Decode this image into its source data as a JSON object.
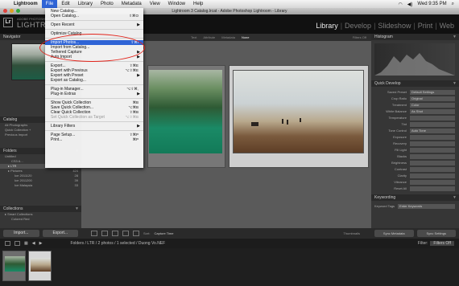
{
  "macbar": {
    "items": [
      "Lightroom",
      "File",
      "Edit",
      "Library",
      "Photo",
      "Metadata",
      "View",
      "Window",
      "Help"
    ],
    "clock": "Wed 9:35 PM"
  },
  "window": {
    "title": "Lightroom 3 Catalog.lrcat - Adobe Photoshop Lightroom - Library"
  },
  "identity": {
    "logo": "Lr",
    "small": "ADOBE PHOTOSHOP",
    "big": "LIGHTROOM"
  },
  "modules": [
    "Library",
    "Develop",
    "Slideshow",
    "Print",
    "Web"
  ],
  "left_panel": {
    "navigator": "Navigator",
    "catalog": "Catalog",
    "catalog_items": [
      "All Photographs",
      "Quick Collection +",
      "Previous Import"
    ],
    "folders": "Folders",
    "folder_items": [
      {
        "name": "Untitled",
        "count": ""
      },
      {
        "name": "CS3 A...",
        "count": ""
      },
      {
        "name": "LTR",
        "count": ""
      },
      {
        "name": "Pictures",
        "count": "424"
      },
      {
        "name": "Ice 2011120",
        "count": "28"
      },
      {
        "name": "Ice 2011200",
        "count": "39"
      },
      {
        "name": "Ice Malaysia",
        "count": "33"
      }
    ],
    "collections": "Collections",
    "collection_items": [
      "Smart Collections",
      "Colored Red"
    ],
    "import_btn": "Import...",
    "export_btn": "Export..."
  },
  "filterbar": {
    "items": [
      "Text",
      "Attribute",
      "Metadata",
      "None"
    ],
    "filters_off": "Filters Off"
  },
  "right_panel": {
    "histogram": "Histogram",
    "quick_develop": "Quick Develop",
    "qd_rows": [
      {
        "label": "Saved Preset",
        "value": "Default Settings"
      },
      {
        "label": "Crop Ratio",
        "value": "Original"
      },
      {
        "label": "Treatment",
        "value": "Color"
      },
      {
        "label": "White Balance",
        "value": "As Shot"
      },
      {
        "label": "Temperature",
        "value": ""
      },
      {
        "label": "Tint",
        "value": ""
      },
      {
        "label": "Tone Control",
        "value": "Auto Tone"
      },
      {
        "label": "Exposure",
        "value": ""
      },
      {
        "label": "Recovery",
        "value": ""
      },
      {
        "label": "Fill Light",
        "value": ""
      },
      {
        "label": "Blacks",
        "value": ""
      },
      {
        "label": "Brightness",
        "value": ""
      },
      {
        "label": "Contrast",
        "value": ""
      },
      {
        "label": "Clarity",
        "value": ""
      },
      {
        "label": "Vibrance",
        "value": ""
      },
      {
        "label": "Reset All",
        "value": ""
      }
    ],
    "keywording": "Keywording",
    "keyword_tags": "Keyword Tags",
    "keyword_value": "Enter Keywords",
    "sync_metadata": "Sync Metadata",
    "sync_settings": "Sync Settings"
  },
  "grid_toolbar": {
    "sort_label": "Sort:",
    "sort_value": "Capture Time",
    "thumbnails": "Thumbnails"
  },
  "filmstrip_bar": {
    "pages": [
      "1",
      "2"
    ],
    "path": "Folders / LTR / 2 photos / 1 selected / Duong Vo.NEF",
    "filter_label": "Filter:",
    "filter_value": "Filters Off"
  },
  "file_menu": {
    "items": [
      {
        "label": "New Catalog...",
        "shortcut": "",
        "type": "item"
      },
      {
        "label": "Open Catalog...",
        "shortcut": "⇧⌘O",
        "type": "item"
      },
      {
        "type": "sep"
      },
      {
        "label": "Open Recent",
        "shortcut": "",
        "type": "submenu"
      },
      {
        "type": "sep"
      },
      {
        "label": "Optimize Catalog...",
        "shortcut": "",
        "type": "item"
      },
      {
        "type": "sep"
      },
      {
        "label": "Import Photos...",
        "shortcut": "⇧⌘I",
        "type": "highlight"
      },
      {
        "label": "Import from Catalog...",
        "shortcut": "",
        "type": "item"
      },
      {
        "label": "Tethered Capture",
        "shortcut": "",
        "type": "submenu"
      },
      {
        "label": "Auto Import",
        "shortcut": "",
        "type": "submenu"
      },
      {
        "type": "sep"
      },
      {
        "label": "Export...",
        "shortcut": "⇧⌘E",
        "type": "item"
      },
      {
        "label": "Export with Previous",
        "shortcut": "⌥⇧⌘E",
        "type": "item"
      },
      {
        "label": "Export with Preset",
        "shortcut": "",
        "type": "submenu"
      },
      {
        "label": "Export as Catalog...",
        "shortcut": "",
        "type": "item"
      },
      {
        "type": "sep"
      },
      {
        "label": "Plug-in Manager...",
        "shortcut": "⌥⇧⌘,",
        "type": "item"
      },
      {
        "label": "Plug-in Extras",
        "shortcut": "",
        "type": "submenu"
      },
      {
        "type": "sep"
      },
      {
        "label": "Show Quick Collection",
        "shortcut": "⌘B",
        "type": "item"
      },
      {
        "label": "Save Quick Collection...",
        "shortcut": "⌥⌘B",
        "type": "item"
      },
      {
        "label": "Clear Quick Collection",
        "shortcut": "⇧⌘B",
        "type": "item"
      },
      {
        "label": "Set Quick Collection as Target",
        "shortcut": "⌥⇧⌘B",
        "type": "disabled"
      },
      {
        "type": "sep"
      },
      {
        "label": "Library Filters",
        "shortcut": "",
        "type": "submenu"
      },
      {
        "type": "sep"
      },
      {
        "label": "Page Setup...",
        "shortcut": "⇧⌘P",
        "type": "item"
      },
      {
        "label": "Print...",
        "shortcut": "⌘P",
        "type": "item"
      }
    ]
  }
}
